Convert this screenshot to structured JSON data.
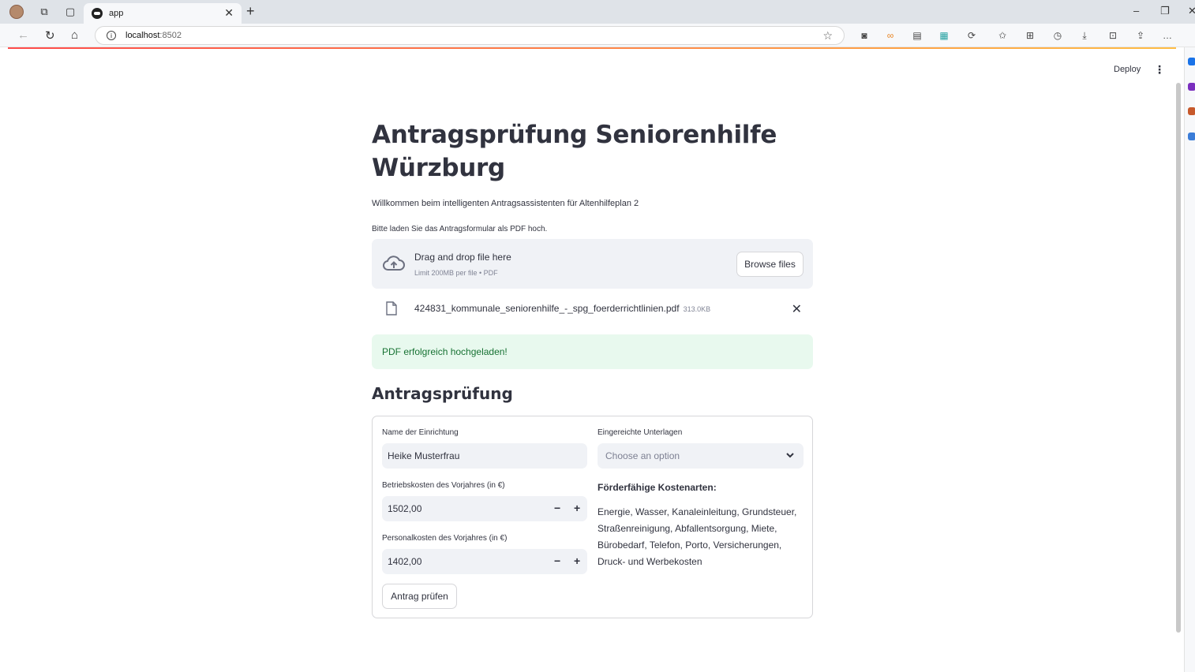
{
  "browser": {
    "tab_title": "app",
    "url_host": "localhost",
    "url_port": ":8502"
  },
  "header": {
    "deploy_label": "Deploy",
    "menu_glyph": "⋮"
  },
  "page": {
    "title": "Antragsprüfung Seniorenhilfe Würzburg",
    "welcome": "Willkommen beim intelligenten Antragsassistenten für Altenhilfeplan 2"
  },
  "uploader": {
    "label": "Bitte laden Sie das Antragsformular als PDF hoch.",
    "drop_text": "Drag and drop file here",
    "limit_text": "Limit 200MB per file • PDF",
    "browse_label": "Browse files",
    "file_name": "424831_kommunale_seniorenhilfe_-_spg_foerderrichtlinien.pdf",
    "file_size": "313.0KB"
  },
  "success_message": "PDF erfolgreich hochgeladen!",
  "form": {
    "heading": "Antragsprüfung",
    "name_label": "Name der Einrichtung",
    "name_value": "Heike Musterfrau",
    "betrieb_label": "Betriebskosten des Vorjahres (in €)",
    "betrieb_value": "1502,00",
    "personal_label": "Personalkosten des Vorjahres (in €)",
    "personal_value": "1402,00",
    "unterlagen_label": "Eingereichte Unterlagen",
    "unterlagen_placeholder": "Choose an option",
    "kostenarten_heading": "Förderfähige Kostenarten:",
    "kostenarten_text": "Energie, Wasser, Kanaleinleitung, Grundsteuer, Straßenreinigung, Abfallentsorgung, Miete, Bürobedarf, Telefon, Porto, Versicherungen, Druck- und Werbekosten",
    "submit_label": "Antrag prüfen",
    "minus": "−",
    "plus": "+"
  },
  "colors": {
    "accent_start": "#ff4b4b",
    "accent_end": "#ffbd45",
    "success_bg": "#e8f9ee",
    "success_text": "#177233",
    "input_bg": "#f0f2f6"
  }
}
